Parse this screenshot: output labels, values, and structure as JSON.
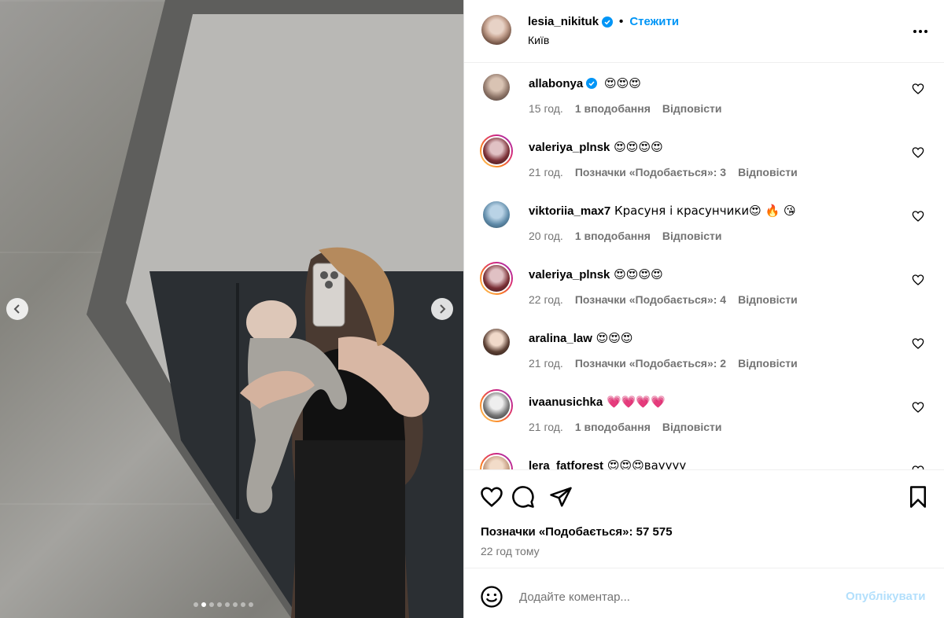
{
  "header": {
    "username": "lesia_nikituk",
    "separator": "•",
    "follow_label": "Стежити",
    "location": "Київ",
    "more_icon": "more-horizontal-icon"
  },
  "colors": {
    "accent": "#0095f6",
    "publish_disabled": "#b2dffc",
    "verified": "#0095f6",
    "muted": "#737373"
  },
  "carousel": {
    "total_slides": 8,
    "active_index": 1,
    "prev_icon": "chevron-left-icon",
    "next_icon": "chevron-right-icon"
  },
  "comments": [
    {
      "user": "allabonya",
      "verified": true,
      "text": "😍😍😍",
      "time": "15 год.",
      "likes": "1 вподобання",
      "reply": "Відповісти"
    },
    {
      "user": "valeriya_plnsk",
      "verified": false,
      "text": "😍😍😍😍",
      "time": "21 год.",
      "likes": "Позначки «Подобається»: 3",
      "reply": "Відповісти"
    },
    {
      "user": "viktoriia_max7",
      "verified": false,
      "text": "Красуня і красунчики😍 🔥 😘",
      "time": "20 год.",
      "likes": "1 вподобання",
      "reply": "Відповісти"
    },
    {
      "user": "valeriya_plnsk",
      "verified": false,
      "text": "😍😍😍😍",
      "time": "22 год.",
      "likes": "Позначки «Подобається»: 4",
      "reply": "Відповісти"
    },
    {
      "user": "aralina_law",
      "verified": false,
      "text": "😍😍😍",
      "time": "21 год.",
      "likes": "Позначки «Подобається»: 2",
      "reply": "Відповісти"
    },
    {
      "user": "ivaanusichka",
      "verified": false,
      "text": "💗💗💗💗",
      "time": "21 год.",
      "likes": "1 вподобання",
      "reply": "Відповісти"
    },
    {
      "user": "lera_fatforest",
      "verified": false,
      "text": "😍😍😍вауууу",
      "time": "",
      "likes": "",
      "reply": ""
    }
  ],
  "post": {
    "likes_label": "Позначки «Подобається»: 57 575",
    "time_ago": "22 год тому"
  },
  "add_comment": {
    "placeholder": "Додайте коментар...",
    "publish_label": "Опублікувати"
  }
}
